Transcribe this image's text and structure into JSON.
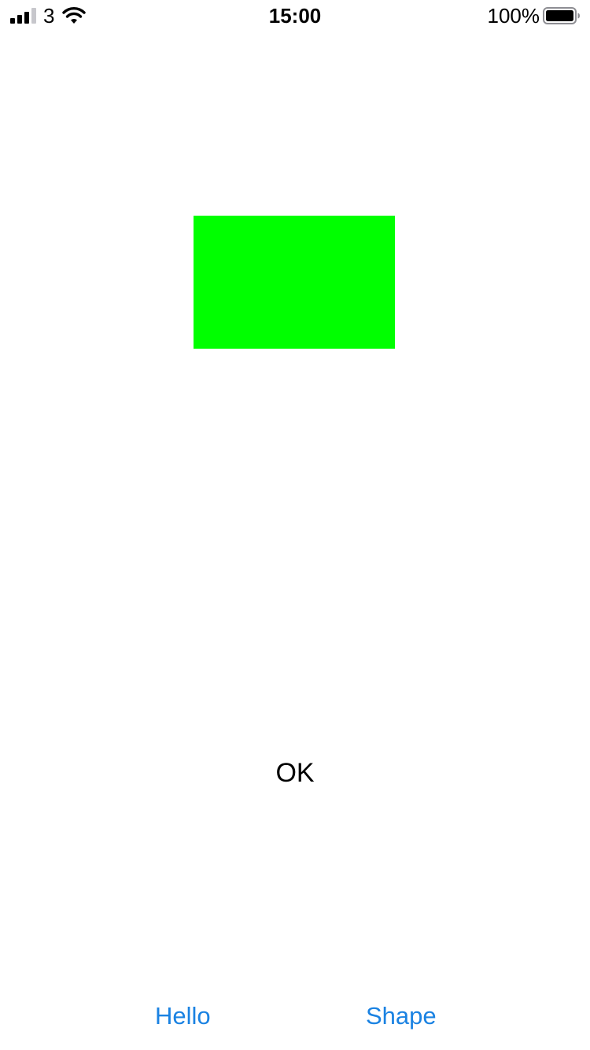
{
  "status_bar": {
    "carrier": "3",
    "time": "15:00",
    "battery_percent": "100%",
    "battery_level": 1.0,
    "signal_bars_filled": 3,
    "signal_bars_total": 4,
    "icons": [
      "signal-icon",
      "wifi-icon",
      "battery-icon"
    ]
  },
  "main": {
    "shape": {
      "color": "#00ff00",
      "kind": "rectangle"
    },
    "label": "OK"
  },
  "bottom": {
    "hello_label": "Hello",
    "shape_label": "Shape",
    "accent_color": "#1a82e2"
  }
}
